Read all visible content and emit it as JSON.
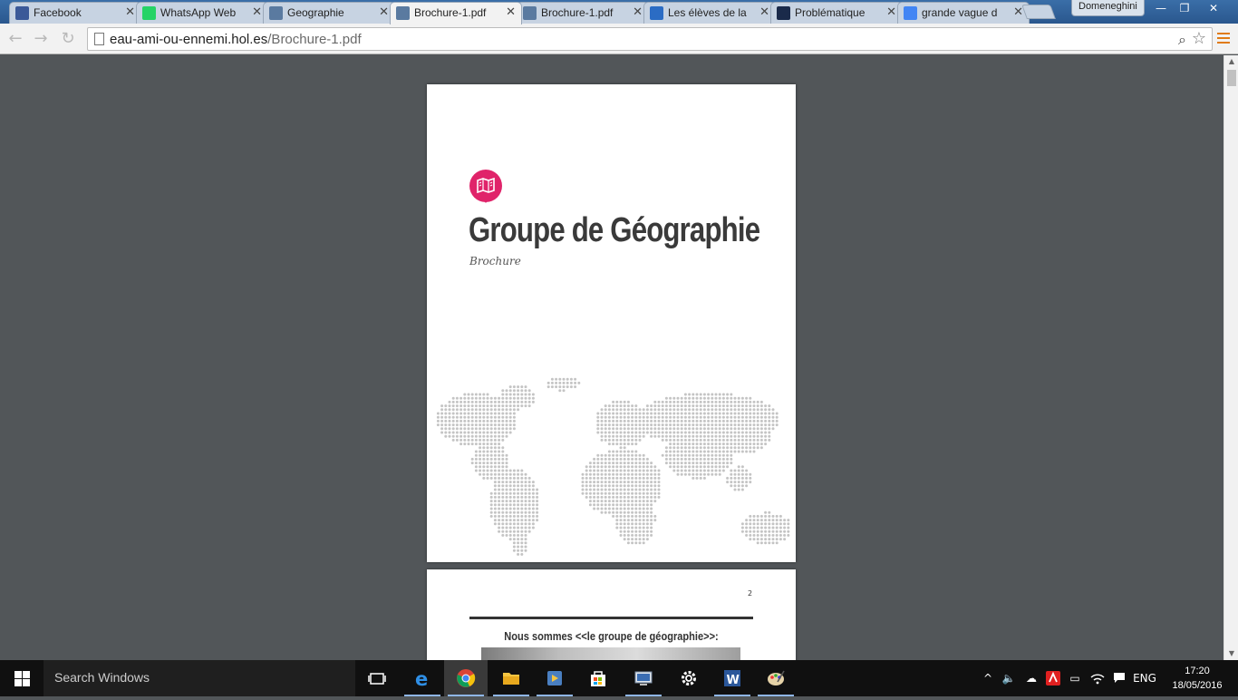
{
  "browser": {
    "tabs": [
      {
        "title": "Facebook",
        "icon": "facebook-icon",
        "color": "#3b5998",
        "active": false
      },
      {
        "title": "WhatsApp Web",
        "icon": "whatsapp-icon",
        "color": "#25d366",
        "active": false
      },
      {
        "title": "Geographie",
        "icon": "site-icon",
        "color": "#5a7aa0",
        "active": false
      },
      {
        "title": "Brochure-1.pdf",
        "icon": "site-icon",
        "color": "#5a7aa0",
        "active": true
      },
      {
        "title": "Brochure-1.pdf",
        "icon": "site-icon",
        "color": "#5a7aa0",
        "active": false
      },
      {
        "title": "Les élèves de la",
        "icon": "document-icon",
        "color": "#2b6cc4",
        "active": false
      },
      {
        "title": "Problématique",
        "icon": "dark-site-icon",
        "color": "#1a2a4a",
        "active": false
      },
      {
        "title": "grande vague d",
        "icon": "google-icon",
        "color": "#4285f4",
        "active": false
      }
    ],
    "profile_name": "Domeneghini",
    "url_host": "eau-ami-ou-ennemi.hol.es",
    "url_path": "/Brochure-1.pdf",
    "accent_menu_color": "#e07b14"
  },
  "document": {
    "page1": {
      "title": "Groupe de Géographie",
      "subtitle": "Brochure",
      "badge_color": "#e0246a",
      "badge_icon": "map-book-icon"
    },
    "page2": {
      "page_number": "2",
      "heading": "Nous sommes <<le groupe de géographie>>:"
    }
  },
  "taskbar": {
    "search_placeholder": "Search Windows",
    "apps": [
      "task-view-icon",
      "edge-icon",
      "chrome-icon",
      "file-explorer-icon",
      "media-player-icon",
      "store-icon",
      "network-app-icon",
      "settings-icon",
      "word-icon",
      "paint-icon"
    ],
    "language": "ENG",
    "time": "17:20",
    "date": "18/05/2016"
  }
}
